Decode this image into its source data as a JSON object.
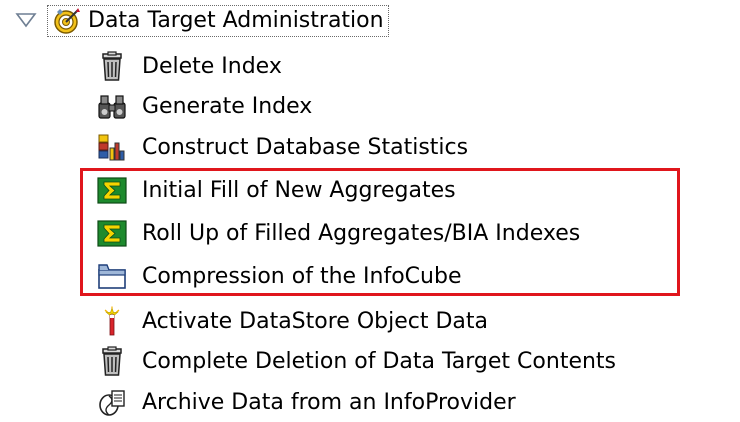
{
  "tree": {
    "root": {
      "label": "Data Target Administration",
      "expanded": true,
      "toggle_icon": "triangle-down-icon",
      "icon": "target-gear-icon"
    },
    "items": [
      {
        "label": "Delete Index",
        "icon": "trash-icon"
      },
      {
        "label": "Generate Index",
        "icon": "binoculars-icon"
      },
      {
        "label": "Construct Database Statistics",
        "icon": "statistics-icon"
      },
      {
        "label": "Initial Fill of New Aggregates",
        "icon": "sigma-icon"
      },
      {
        "label": "Roll Up of Filled Aggregates/BIA Indexes",
        "icon": "sigma-icon"
      },
      {
        "label": "Compression of the InfoCube",
        "icon": "compress-icon"
      },
      {
        "label": "Activate DataStore Object Data",
        "icon": "activate-icon"
      },
      {
        "label": "Complete Deletion of Data Target Contents",
        "icon": "trash-icon"
      },
      {
        "label": "Archive Data from an InfoProvider",
        "icon": "archive-icon"
      }
    ]
  },
  "annotation": {
    "highlight_color": "#e0161c"
  }
}
